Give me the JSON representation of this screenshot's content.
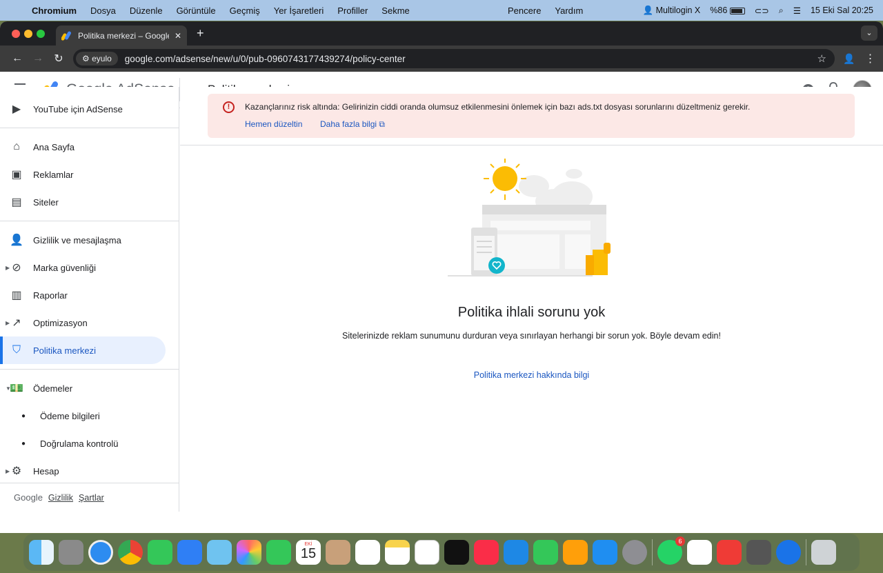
{
  "menubar": {
    "app": "Chromium",
    "items": [
      "Dosya",
      "Düzenle",
      "Görüntüle",
      "Geçmiş",
      "Yer İşaretleri",
      "Profiller",
      "Sekme"
    ],
    "mid_items": [
      "Pencere",
      "Yardım"
    ],
    "status_app": "Multilogin X",
    "battery": "%86",
    "datetime": "15 Eki Sal  20:25"
  },
  "browser": {
    "tab_title": "Politika merkezi – Google AdSense",
    "site_chip": "eyulo",
    "url": "google.com/adsense/new/u/0/pub-0960743177439274/policy-center"
  },
  "header": {
    "logo_text": "Google AdSense",
    "page_title": "Politika merkezi"
  },
  "sidebar": {
    "youtube": "YouTube için AdSense",
    "home": "Ana Sayfa",
    "ads": "Reklamlar",
    "sites": "Siteler",
    "privacy": "Gizlilik ve mesajlaşma",
    "brand": "Marka güvenliği",
    "reports": "Raporlar",
    "optimization": "Optimizasyon",
    "policy": "Politika merkezi",
    "payments": "Ödemeler",
    "payment_info": "Ödeme bilgileri",
    "verification": "Doğrulama kontrolü",
    "account": "Hesap",
    "footer_google": "Google",
    "footer_privacy": "Gizlilik",
    "footer_terms": "Şartlar"
  },
  "alert": {
    "message": "Kazançlarınız risk altında: Gelirinizin ciddi oranda olumsuz etkilenmesini önlemek için bazı ads.txt dosyası sorunlarını düzeltmeniz gerekir.",
    "fix_link": "Hemen düzeltin",
    "more_link": "Daha fazla bilgi"
  },
  "empty_state": {
    "title": "Politika ihlali sorunu yok",
    "description": "Sitelerinizde reklam sunumunu durduran veya sınırlayan herhangi bir sorun yok. Böyle devam edin!",
    "learn_link": "Politika merkezi hakkında bilgi"
  },
  "dock": {
    "calendar_month": "EKİ",
    "calendar_day": "15",
    "whatsapp_badge": "6",
    "apps": [
      "finder",
      "launchpad",
      "safari",
      "chrome",
      "messages",
      "mail",
      "maps",
      "photos",
      "facetime",
      "calendar",
      "contacts",
      "reminders",
      "notes",
      "freeform",
      "tv",
      "music",
      "keynote",
      "numbers",
      "pages",
      "app-store",
      "settings",
      "whatsapp",
      "multilogin",
      "anydesk",
      "calculator",
      "chromium",
      "trash"
    ]
  },
  "colors": {
    "accent": "#1a73e8",
    "link": "#1a56c0",
    "alert_bg": "#fce8e6",
    "alert_icon": "#c5221f",
    "menubar_bg": "#a9c6e6"
  }
}
